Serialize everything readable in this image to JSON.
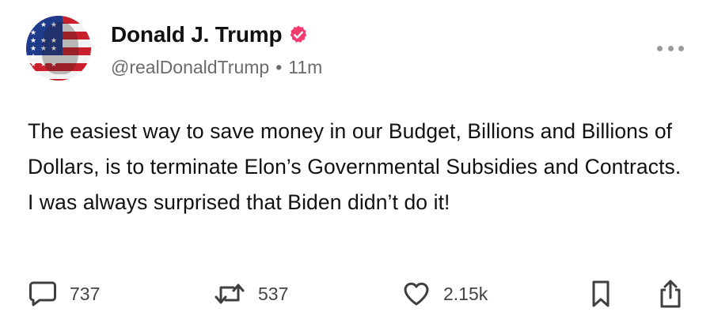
{
  "author": {
    "display_name": "Donald J. Trump",
    "handle": "@realDonaldTrump",
    "separator": "•",
    "time_ago": "11m"
  },
  "post": {
    "text": "The easiest way to save money in our Budget, Billions and Billions of Dollars, is to terminate Elon’s Governmental Subsidies and Contracts. I was always surprised that Biden didn’t do it!"
  },
  "actions": {
    "reply_count": "737",
    "repost_count": "537",
    "like_count": "2.15k"
  },
  "colors": {
    "verified_badge": "#f23b71",
    "text": "#111111",
    "secondary_text": "#6b6b6b",
    "icon": "#3f3f3f"
  },
  "icons": {
    "verified": "verified-badge-icon",
    "more": "more-dots-icon",
    "reply": "comment-icon",
    "repost": "repost-icon",
    "like": "heart-icon",
    "bookmark": "bookmark-icon",
    "share": "share-icon"
  }
}
